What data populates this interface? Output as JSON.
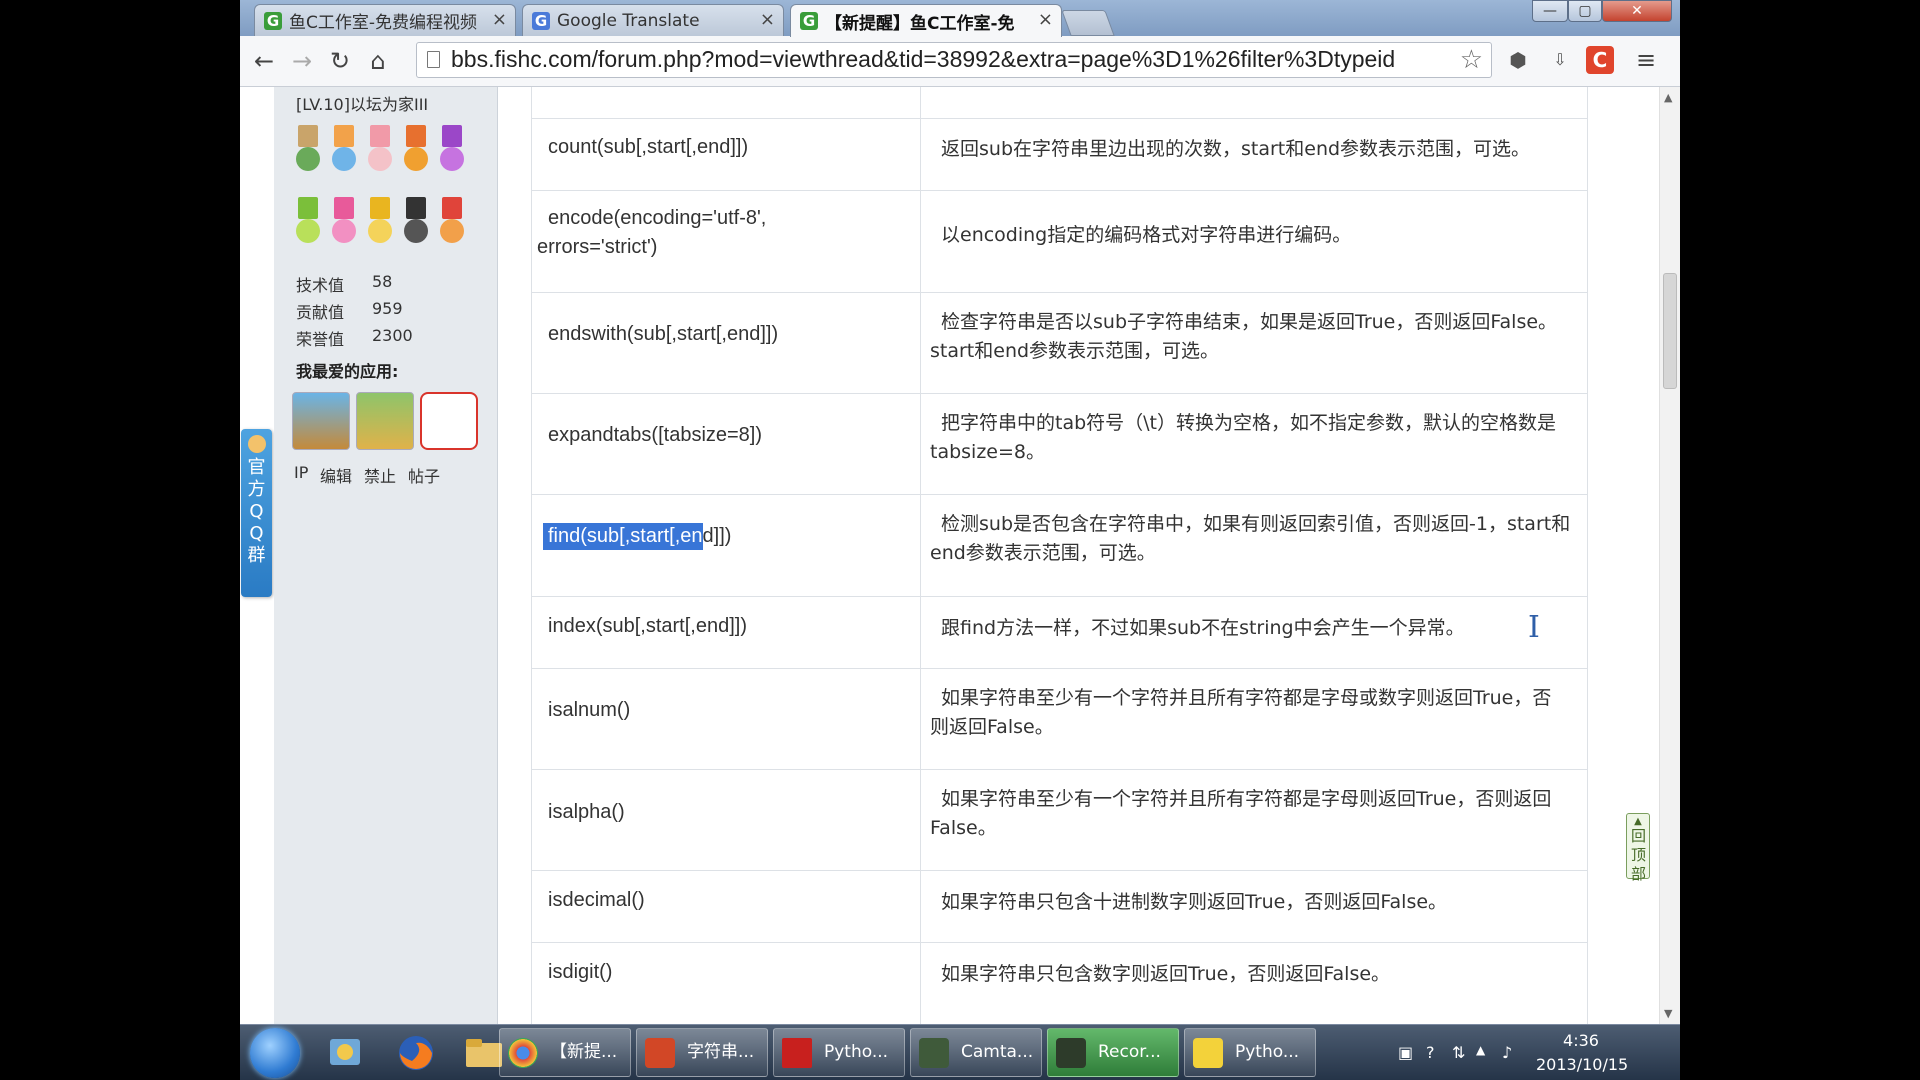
{
  "browser": {
    "tabs": [
      {
        "label": "鱼C工作室-免费编程视频",
        "icon": "fishc-favicon"
      },
      {
        "label": "Google Translate",
        "icon": "google-translate-favicon"
      },
      {
        "label": "【新提醒】鱼C工作室-免",
        "icon": "fishc-favicon"
      }
    ],
    "active_tab": 2,
    "window_buttons": {
      "minimize": "—",
      "maximize": "▢",
      "close": "✕"
    },
    "url": "bbs.fishc.com/forum.php?mod=viewthread&tid=38992&extra=page%3D1%26filter%3Dtypeid"
  },
  "sidebar": {
    "user_level": "[LV.10]以坛为家III",
    "stats": [
      {
        "label": "技术值",
        "value": "58"
      },
      {
        "label": "贡献值",
        "value": "959"
      },
      {
        "label": "荣誉值",
        "value": "2300"
      }
    ],
    "apps_title": "我最爱的应用:",
    "apps": [
      "game-app-icon",
      "five-minutes-app-icon",
      "photo-app-icon"
    ],
    "actions": [
      "IP",
      "编辑",
      "禁止",
      "帖子"
    ],
    "qq_group_label": "官方QQ群"
  },
  "table": {
    "rows": [
      {
        "method": "count(sub[,start[,end]])",
        "desc": "返回sub在字符串里边出现的次数，start和end参数表示范围，可选。"
      },
      {
        "method_lines": [
          "encode(encoding='utf-8',",
          "errors='strict')"
        ],
        "desc": "以encoding指定的编码格式对字符串进行编码。"
      },
      {
        "method": "endswith(sub[,start[,end]])",
        "desc_lines": [
          "检查字符串是否以sub子字符串结束，如果是返回True，否则返回False。",
          "start和end参数表示范围，可选。"
        ]
      },
      {
        "method": "expandtabs([tabsize=8])",
        "desc_lines": [
          "把字符串中的tab符号（\\t）转换为空格，如不指定参数，默认的空格数是",
          "tabsize=8。"
        ]
      },
      {
        "method_selected": "find(sub[,start[,en",
        "method_rest": "d]])",
        "desc_lines": [
          "检测sub是否包含在字符串中，如果有则返回索引值，否则返回-1，start和",
          "end参数表示范围，可选。"
        ]
      },
      {
        "method": "index(sub[,start[,end]])",
        "desc": "跟find方法一样，不过如果sub不在string中会产生一个异常。"
      },
      {
        "method": "isalnum()",
        "desc_lines": [
          "如果字符串至少有一个字符并且所有字符都是字母或数字则返回True，否",
          "则返回False。"
        ]
      },
      {
        "method": "isalpha()",
        "desc_lines": [
          "如果字符串至少有一个字符并且所有字符都是字母则返回True，否则返回",
          "False。"
        ]
      },
      {
        "method": "isdecimal()",
        "desc": "如果字符串只包含十进制数字则返回True，否则返回False。"
      },
      {
        "method": "isdigit()",
        "desc": "如果字符串只包含数字则返回True，否则返回False。"
      }
    ]
  },
  "back_to_top": "回顶部",
  "taskbar": {
    "tasks": [
      {
        "label": "【新提...",
        "icon": "chrome-icon"
      },
      {
        "label": "字符串...",
        "icon": "powerpoint-icon"
      },
      {
        "label": "Pytho...",
        "icon": "python-editor-icon"
      },
      {
        "label": "Camta...",
        "icon": "camtasia-icon"
      },
      {
        "label": "Recor...",
        "icon": "recorder-icon"
      },
      {
        "label": "Pytho...",
        "icon": "python-help-icon"
      }
    ],
    "active_task": 4,
    "clock_time": "4:36",
    "clock_date": "2013/10/15"
  },
  "colors": {
    "selection": "#3875d7",
    "qq_tab": "#2a7bc4",
    "active_task": "#3d9445"
  }
}
